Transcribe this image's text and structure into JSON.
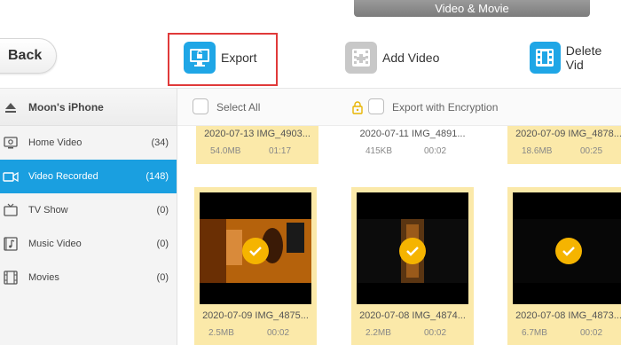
{
  "window": {
    "title": "Video & Movie"
  },
  "toolbar": {
    "back_label": "Back",
    "export_label": "Export",
    "add_video_label": "Add Video",
    "delete_label": "Delete Vid"
  },
  "sidebar": {
    "device_name": "Moon's iPhone",
    "items": [
      {
        "label": "Home Video",
        "count": "(34)"
      },
      {
        "label": "Video Recorded",
        "count": "(148)"
      },
      {
        "label": "TV Show",
        "count": "(0)"
      },
      {
        "label": "Music Video",
        "count": "(0)"
      },
      {
        "label": "Movies",
        "count": "(0)"
      }
    ],
    "active_index": 1
  },
  "selection_bar": {
    "select_all_label": "Select All",
    "encrypt_label": "Export with Encryption"
  },
  "videos_top": [
    {
      "date": "2020-07-13  IMG_4903...",
      "size": "54.0MB",
      "duration": "01:17",
      "selected": true
    },
    {
      "date": "2020-07-11  IMG_4891...",
      "size": "415KB",
      "duration": "00:02",
      "selected": false
    },
    {
      "date": "2020-07-09  IMG_4878...",
      "size": "18.6MB",
      "duration": "00:25",
      "selected": true
    }
  ],
  "videos_bottom": [
    {
      "date": "2020-07-09  IMG_4875...",
      "size": "2.5MB",
      "duration": "00:02",
      "selected": true
    },
    {
      "date": "2020-07-08  IMG_4874...",
      "size": "2.2MB",
      "duration": "00:02",
      "selected": true
    },
    {
      "date": "2020-07-08  IMG_4873...",
      "size": "6.7MB",
      "duration": "00:02",
      "selected": true
    }
  ],
  "colors": {
    "accent": "#1a9fe0",
    "selected_card": "#fbe9a9",
    "check_badge": "#f5b400",
    "highlight_border": "#e03a3a"
  }
}
